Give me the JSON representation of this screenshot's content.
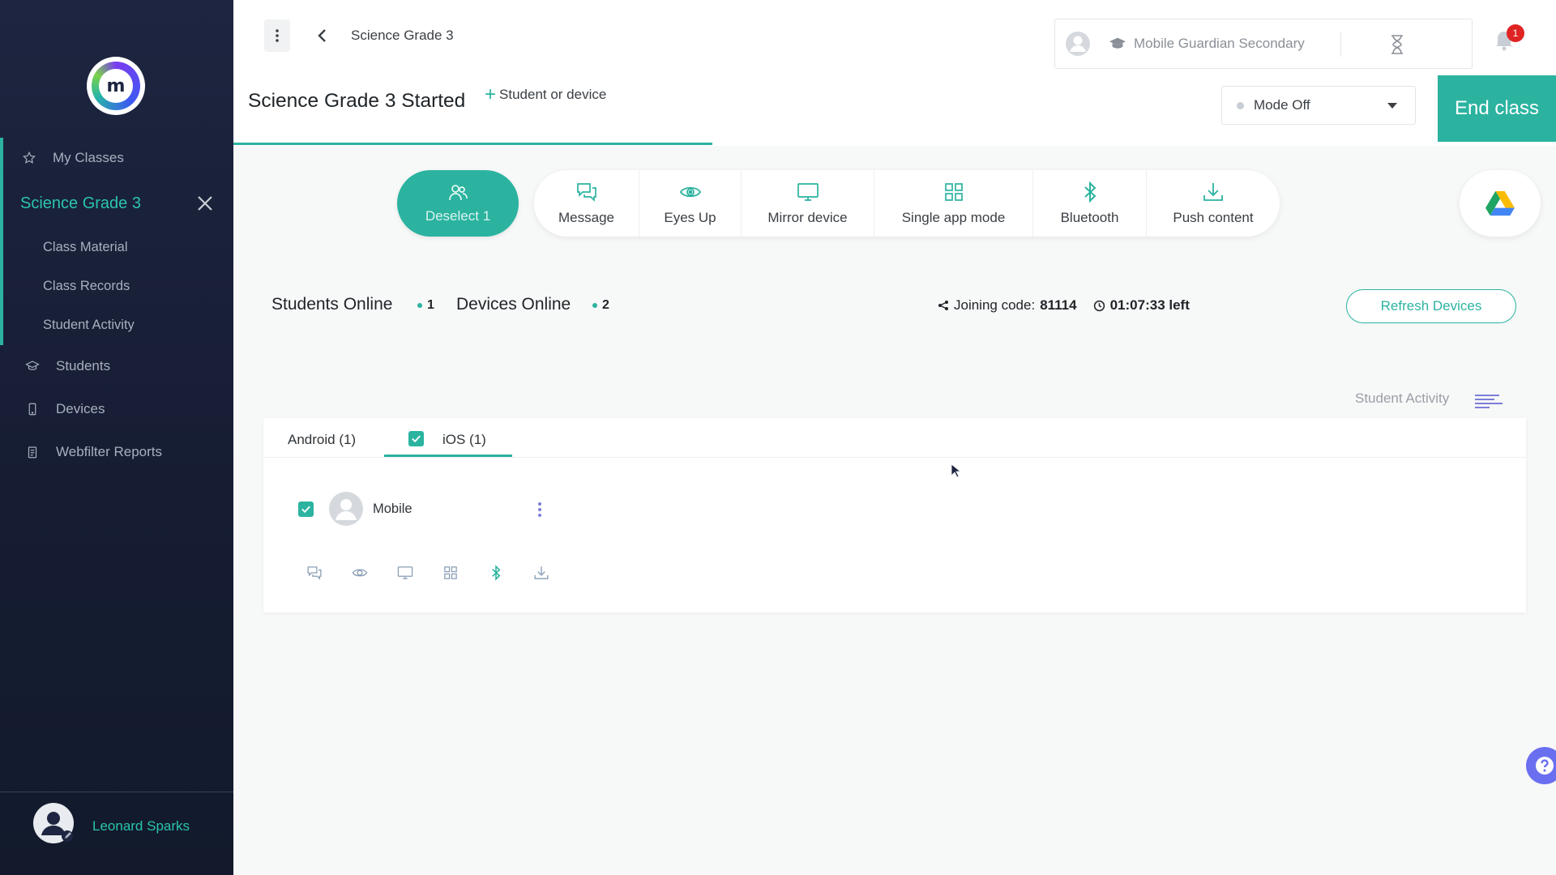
{
  "sidebar": {
    "nav": {
      "my_classes": "My Classes",
      "active_class": "Science Grade 3",
      "sub_items": [
        "Class Material",
        "Class Records",
        "Student Activity"
      ],
      "students": "Students",
      "devices": "Devices",
      "webfilter": "Webfilter Reports"
    },
    "user": {
      "name": "Leonard Sparks"
    }
  },
  "header": {
    "breadcrumb": "Science Grade 3",
    "school_name": "Mobile Guardian Secondary",
    "notification_count": "1",
    "page_title": "Science Grade 3 Started",
    "add_student_label": "Student or device",
    "mode": {
      "selected": "Mode Off"
    },
    "end_class_label": "End class"
  },
  "toolbar": {
    "deselect_label": "Deselect 1",
    "tools": [
      {
        "label": "Message",
        "icon": "message-icon"
      },
      {
        "label": "Eyes Up",
        "icon": "eye-icon"
      },
      {
        "label": "Mirror device",
        "icon": "monitor-icon"
      },
      {
        "label": "Single app mode",
        "icon": "grid-icon"
      },
      {
        "label": "Bluetooth",
        "icon": "bluetooth-icon"
      },
      {
        "label": "Push content",
        "icon": "download-icon"
      }
    ]
  },
  "status": {
    "students_online_label": "Students Online",
    "students_online_count": "1",
    "devices_online_label": "Devices Online",
    "devices_online_count": "2",
    "joining_code_label": "Joining code:",
    "joining_code": "81114",
    "time_left": "01:07:33 left",
    "refresh_label": "Refresh Devices",
    "activity_label": "Student Activity"
  },
  "devices_panel": {
    "tabs": [
      {
        "label": "Android (1)",
        "active": false
      },
      {
        "label": "iOS (1)",
        "active": true,
        "checked": true
      }
    ],
    "devices": [
      {
        "name": "Mobile",
        "checked": true
      }
    ]
  },
  "colors": {
    "accent": "#2bb3a0",
    "sidebar_bg": "#1d2540",
    "badge": "#e02424",
    "help": "#6a6ff0"
  }
}
